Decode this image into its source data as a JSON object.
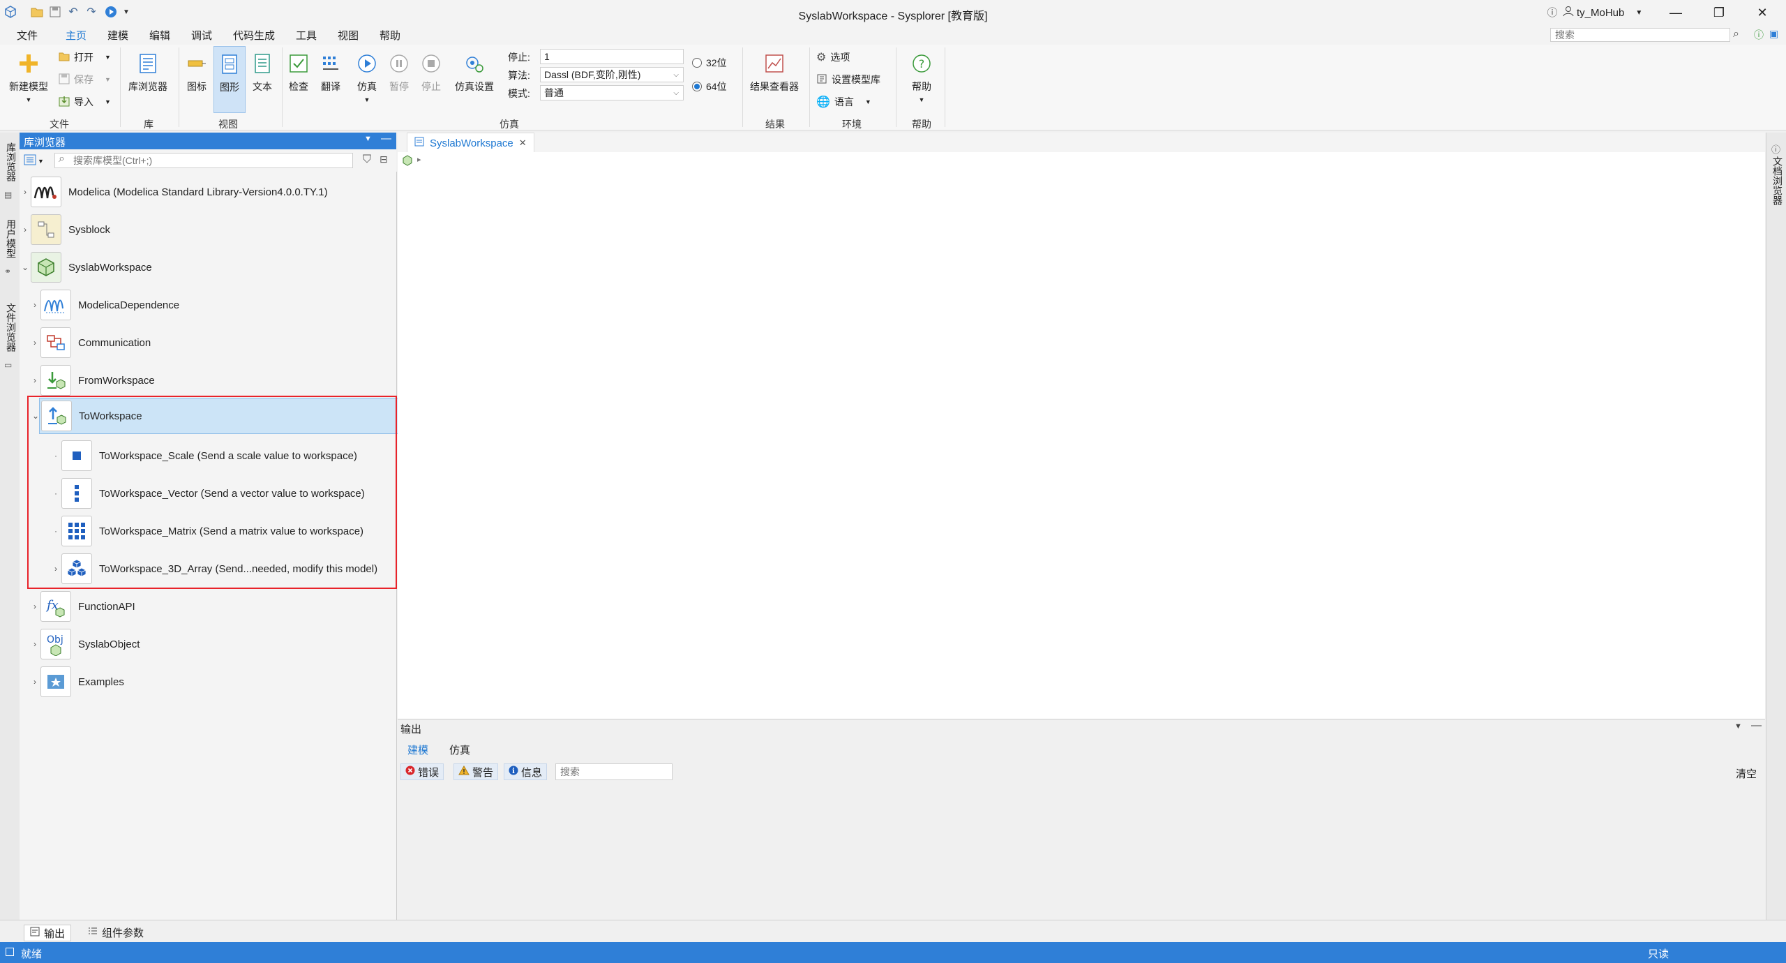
{
  "app": {
    "title": "SyslabWorkspace - Sysplorer [教育版]",
    "user": "ty_MoHub",
    "search_placeholder": "搜索"
  },
  "menu": [
    "文件",
    "主页",
    "建模",
    "编辑",
    "调试",
    "代码生成",
    "工具",
    "视图",
    "帮助"
  ],
  "ribbon": {
    "file": {
      "new_model": "新建模型",
      "open": "打开",
      "save": "保存",
      "import": "导入",
      "group": "文件"
    },
    "lib": {
      "browser": "库浏览器",
      "group": "库"
    },
    "view": {
      "icon": "图标",
      "diagram": "图形",
      "text": "文本",
      "group": "视图"
    },
    "sim": {
      "check": "检查",
      "translate": "翻译",
      "simulate": "仿真",
      "pause": "暂停",
      "stop": "停止",
      "settings": "仿真设置",
      "stop_label": "停止:",
      "stop_value": "1",
      "algo_label": "算法:",
      "algo_value": "Dassl (BDF,变阶,刚性)",
      "mode_label": "模式:",
      "mode_value": "普通",
      "bit32": "32位",
      "bit64": "64位",
      "group": "仿真"
    },
    "result": {
      "viewer": "结果查看器",
      "group": "结果"
    },
    "env": {
      "options": "选项",
      "set_lib": "设置模型库",
      "language": "语言",
      "group": "环境"
    },
    "help": {
      "help": "帮助",
      "group": "帮助"
    }
  },
  "left_strip": [
    "库浏览器",
    "用户模型",
    "文件浏览器"
  ],
  "right_strip": [
    "文档浏览器"
  ],
  "library": {
    "title": "库浏览器",
    "search_placeholder": "搜索库模型(Ctrl+;)",
    "items": [
      {
        "label": "Modelica (Modelica Standard Library-Version4.0.0.TY.1)",
        "icon": "modelica-icon"
      },
      {
        "label": "Sysblock",
        "icon": "sysblock-icon"
      },
      {
        "label": "SyslabWorkspace",
        "icon": "syslab-workspace-icon"
      },
      {
        "label": "ModelicaDependence",
        "icon": "modelica-dependence-icon"
      },
      {
        "label": "Communication",
        "icon": "communication-icon"
      },
      {
        "label": "FromWorkspace",
        "icon": "from-workspace-icon"
      },
      {
        "label": "ToWorkspace",
        "icon": "to-workspace-icon"
      },
      {
        "label": "ToWorkspace_Scale (Send a scale value to workspace)",
        "icon": "scale-icon"
      },
      {
        "label": "ToWorkspace_Vector (Send a vector value to workspace)",
        "icon": "vector-icon"
      },
      {
        "label": "ToWorkspace_Matrix (Send a matrix value to workspace)",
        "icon": "matrix-icon"
      },
      {
        "label": "ToWorkspace_3D_Array (Send...needed, modify this model)",
        "icon": "3d-array-icon"
      },
      {
        "label": "FunctionAPI",
        "icon": "function-api-icon"
      },
      {
        "label": "SyslabObject",
        "icon": "syslab-object-icon"
      },
      {
        "label": "Examples",
        "icon": "examples-icon"
      }
    ]
  },
  "document": {
    "tab": "SyslabWorkspace"
  },
  "output": {
    "title": "输出",
    "tabs": [
      "建模",
      "仿真"
    ],
    "filters": {
      "error": "错误",
      "warning": "警告",
      "info": "信息"
    },
    "search_placeholder": "搜索",
    "clear": "清空"
  },
  "bottom_tabs": [
    "输出",
    "组件参数"
  ],
  "status": {
    "left": "就绪",
    "right": "只读"
  },
  "colors": {
    "accent": "#1e78d2",
    "status_bar": "#2f7fd7",
    "highlight": "#e8232a"
  }
}
